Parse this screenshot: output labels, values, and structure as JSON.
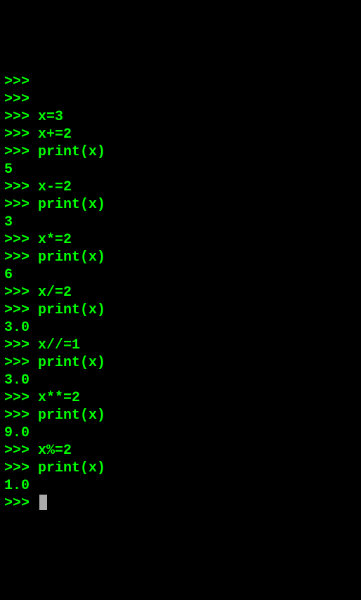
{
  "prompt": ">>>",
  "lines": [
    {
      "type": "prompt_only"
    },
    {
      "type": "prompt_only"
    },
    {
      "type": "input",
      "code": "x=3"
    },
    {
      "type": "input",
      "code": "x+=2"
    },
    {
      "type": "input",
      "code": "print(x)"
    },
    {
      "type": "output",
      "text": "5"
    },
    {
      "type": "input",
      "code": "x-=2"
    },
    {
      "type": "input",
      "code": "print(x)"
    },
    {
      "type": "output",
      "text": "3"
    },
    {
      "type": "input",
      "code": "x*=2"
    },
    {
      "type": "input",
      "code": "print(x)"
    },
    {
      "type": "output",
      "text": "6"
    },
    {
      "type": "input",
      "code": "x/=2"
    },
    {
      "type": "input",
      "code": "print(x)"
    },
    {
      "type": "output",
      "text": "3.0"
    },
    {
      "type": "input",
      "code": "x//=1"
    },
    {
      "type": "input",
      "code": "print(x)"
    },
    {
      "type": "output",
      "text": "3.0"
    },
    {
      "type": "input",
      "code": "x**=2"
    },
    {
      "type": "input",
      "code": "print(x)"
    },
    {
      "type": "output",
      "text": "9.0"
    },
    {
      "type": "input",
      "code": "x%=2"
    },
    {
      "type": "input",
      "code": "print(x)"
    },
    {
      "type": "output",
      "text": "1.0"
    },
    {
      "type": "cursor"
    }
  ]
}
